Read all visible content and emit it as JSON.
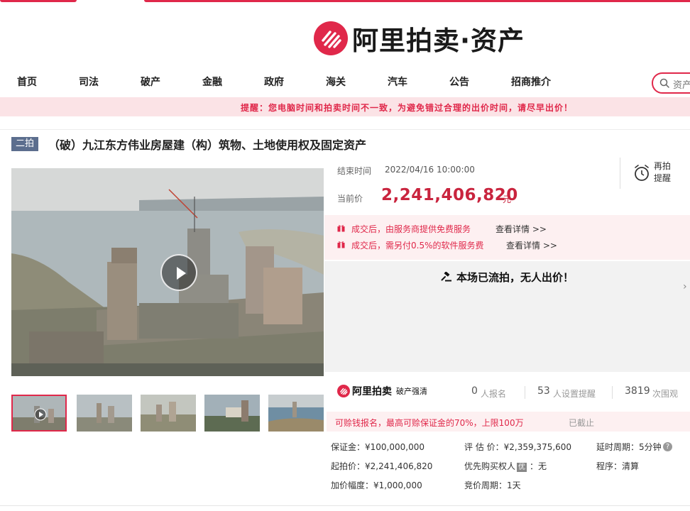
{
  "brand": {
    "logo_text": "阿里拍卖·资产"
  },
  "nav": {
    "items": [
      "首页",
      "司法",
      "破产",
      "金融",
      "政府",
      "海关",
      "汽车",
      "公告",
      "招商推介"
    ],
    "search_placeholder": "资产"
  },
  "notice": "提醒：您电脑时间和拍卖时间不一致，为避免错过合理的出价时间，请尽早出价！",
  "item": {
    "round_badge": "二拍",
    "title": "（破）九江东方伟业房屋建（构）筑物、土地使用权及固定资产"
  },
  "auction": {
    "end_time_label": "结束时间",
    "end_time": "2022/04/16 10:00:00",
    "current_price_label": "当前价",
    "current_price": "2,241,406,820",
    "price_unit": "元",
    "remind_label": "再拍提醒"
  },
  "services": [
    {
      "text": "成交后，由服务商提供免费服务",
      "link": "查看详情 >>"
    },
    {
      "text": "成交后，需另付0.5%的软件服务费",
      "link": "查看详情 >>"
    }
  ],
  "status": {
    "message": "本场已流拍，无人出价！"
  },
  "stats": {
    "brand_name": "阿里拍卖",
    "brand_sub": "破产强清",
    "signups": "0",
    "signups_label": "人报名",
    "reminders": "53",
    "reminders_label": "人设置提醒",
    "views": "3819",
    "views_label": "次围观"
  },
  "credit": {
    "text": "可赊钱报名，最高可赊保证金的70%，上限100万",
    "status": "已截止"
  },
  "details": {
    "deposit": "保证金：¥100,000,000",
    "appraisal": "评 估 价：¥2,359,375,600",
    "extension": "延时周期：5分钟",
    "start_price": "起拍价：¥2,241,406,820",
    "priority_label": "优先购买权人",
    "priority_tag": "优",
    "priority_value": "：无",
    "procedure_label": "程序：",
    "procedure_value": "清算",
    "increment": "加价幅度：¥1,000,000",
    "bid_cycle": "竞价周期：1天"
  },
  "colors": {
    "accent": "#e0284a",
    "price": "#c9243e",
    "badge": "#5c6e8e"
  },
  "icons": [
    "search-icon",
    "alarm-clock-icon",
    "gift-icon",
    "auction-hammer-icon",
    "play-icon",
    "question-icon"
  ]
}
